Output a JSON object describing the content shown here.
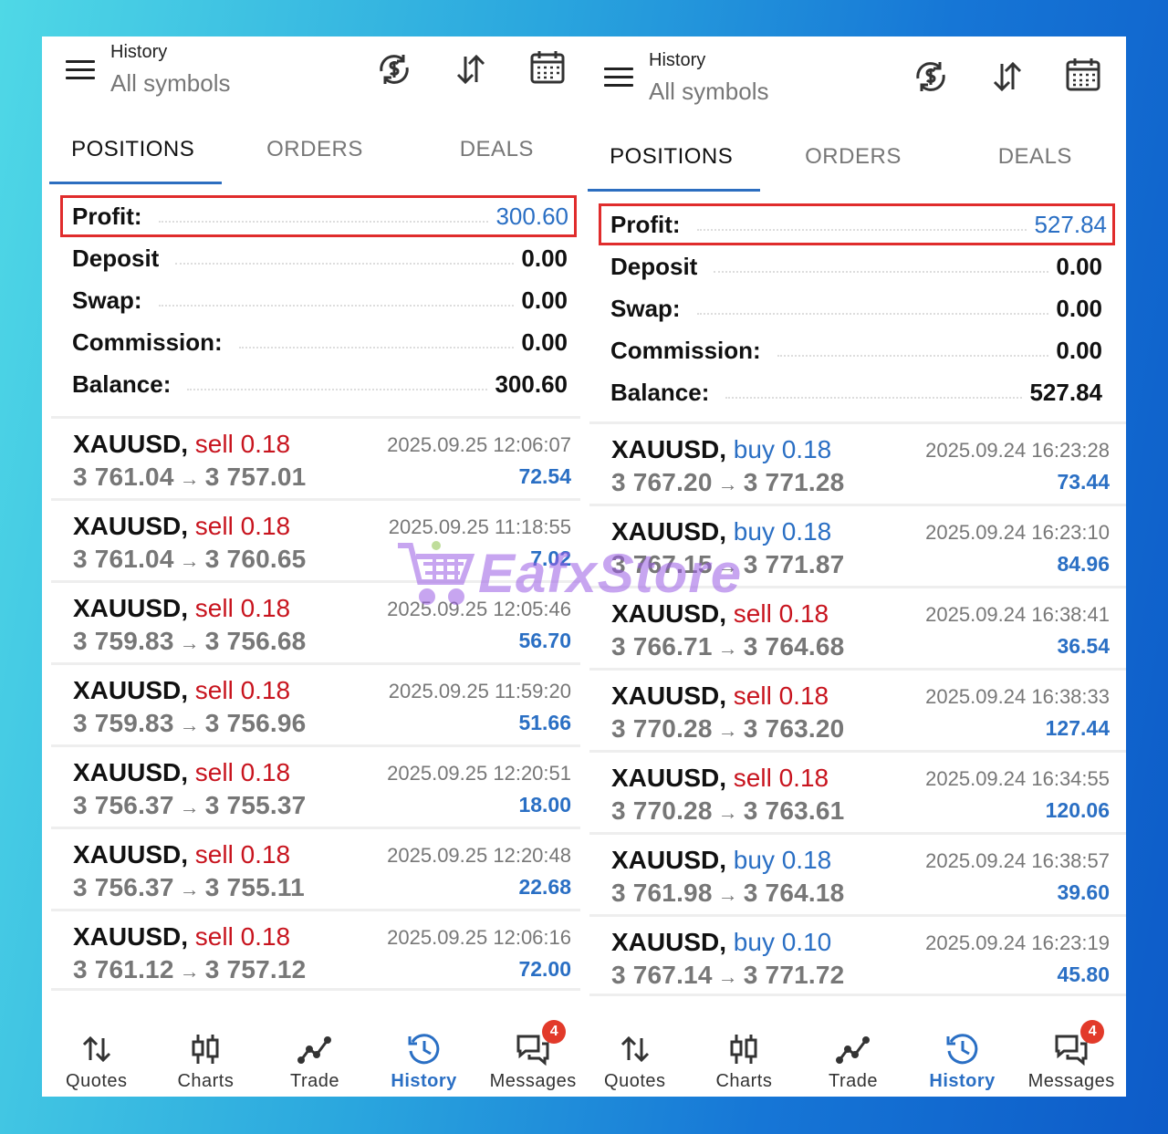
{
  "colors": {
    "profit_box": "#e02c2c",
    "accent_blue": "#2a6fc4",
    "sell_red": "#c8141e",
    "badge_red": "#e23a2a",
    "watermark_purple": "#9b5de5"
  },
  "watermark": {
    "text": "EafxStore",
    "icon": "shopping-cart-icon"
  },
  "left": {
    "header": {
      "title": "History",
      "subtitle": "All symbols"
    },
    "tabs": [
      {
        "label": "POSITIONS",
        "active": true
      },
      {
        "label": "ORDERS",
        "active": false
      },
      {
        "label": "DEALS",
        "active": false
      }
    ],
    "summary": {
      "profit": {
        "label": "Profit:",
        "value": "300.60"
      },
      "deposit": {
        "label": "Deposit",
        "value": "0.00"
      },
      "swap": {
        "label": "Swap:",
        "value": "0.00"
      },
      "commission": {
        "label": "Commission:",
        "value": "0.00"
      },
      "balance": {
        "label": "Balance:",
        "value": "300.60"
      }
    },
    "deals": [
      {
        "symbol": "XAUUSD,",
        "side": "sell 0.18",
        "type": "sell",
        "open": "3 761.04",
        "close": "3 757.01",
        "time": "2025.09.25 12:06:07",
        "profit": "72.54"
      },
      {
        "symbol": "XAUUSD,",
        "side": "sell 0.18",
        "type": "sell",
        "open": "3 761.04",
        "close": "3 760.65",
        "time": "2025.09.25 11:18:55",
        "profit": "7.02"
      },
      {
        "symbol": "XAUUSD,",
        "side": "sell 0.18",
        "type": "sell",
        "open": "3 759.83",
        "close": "3 756.68",
        "time": "2025.09.25 12:05:46",
        "profit": "56.70"
      },
      {
        "symbol": "XAUUSD,",
        "side": "sell 0.18",
        "type": "sell",
        "open": "3 759.83",
        "close": "3 756.96",
        "time": "2025.09.25 11:59:20",
        "profit": "51.66"
      },
      {
        "symbol": "XAUUSD,",
        "side": "sell 0.18",
        "type": "sell",
        "open": "3 756.37",
        "close": "3 755.37",
        "time": "2025.09.25 12:20:51",
        "profit": "18.00"
      },
      {
        "symbol": "XAUUSD,",
        "side": "sell 0.18",
        "type": "sell",
        "open": "3 756.37",
        "close": "3 755.11",
        "time": "2025.09.25 12:20:48",
        "profit": "22.68"
      },
      {
        "symbol": "XAUUSD,",
        "side": "sell 0.18",
        "type": "sell",
        "open": "3 761.12",
        "close": "3 757.12",
        "time": "2025.09.25 12:06:16",
        "profit": "72.00"
      }
    ],
    "nav": [
      {
        "label": "Quotes",
        "icon": "quotes-arrows-icon",
        "active": false
      },
      {
        "label": "Charts",
        "icon": "candlestick-chart-icon",
        "active": false
      },
      {
        "label": "Trade",
        "icon": "trade-line-icon",
        "active": false
      },
      {
        "label": "History",
        "icon": "history-clock-icon",
        "active": true
      },
      {
        "label": "Messages",
        "icon": "messages-chat-icon",
        "active": false,
        "badge": "4"
      }
    ]
  },
  "right": {
    "header": {
      "title": "History",
      "subtitle": "All symbols"
    },
    "tabs": [
      {
        "label": "POSITIONS",
        "active": true
      },
      {
        "label": "ORDERS",
        "active": false
      },
      {
        "label": "DEALS",
        "active": false
      }
    ],
    "summary": {
      "profit": {
        "label": "Profit:",
        "value": "527.84"
      },
      "deposit": {
        "label": "Deposit",
        "value": "0.00"
      },
      "swap": {
        "label": "Swap:",
        "value": "0.00"
      },
      "commission": {
        "label": "Commission:",
        "value": "0.00"
      },
      "balance": {
        "label": "Balance:",
        "value": "527.84"
      }
    },
    "deals": [
      {
        "symbol": "XAUUSD,",
        "side": "buy 0.18",
        "type": "buy",
        "open": "3 767.20",
        "close": "3 771.28",
        "time": "2025.09.24 16:23:28",
        "profit": "73.44"
      },
      {
        "symbol": "XAUUSD,",
        "side": "buy 0.18",
        "type": "buy",
        "open": "3 767.15",
        "close": "3 771.87",
        "time": "2025.09.24 16:23:10",
        "profit": "84.96"
      },
      {
        "symbol": "XAUUSD,",
        "side": "sell 0.18",
        "type": "sell",
        "open": "3 766.71",
        "close": "3 764.68",
        "time": "2025.09.24 16:38:41",
        "profit": "36.54"
      },
      {
        "symbol": "XAUUSD,",
        "side": "sell 0.18",
        "type": "sell",
        "open": "3 770.28",
        "close": "3 763.20",
        "time": "2025.09.24 16:38:33",
        "profit": "127.44"
      },
      {
        "symbol": "XAUUSD,",
        "side": "sell 0.18",
        "type": "sell",
        "open": "3 770.28",
        "close": "3 763.61",
        "time": "2025.09.24 16:34:55",
        "profit": "120.06"
      },
      {
        "symbol": "XAUUSD,",
        "side": "buy 0.18",
        "type": "buy",
        "open": "3 761.98",
        "close": "3 764.18",
        "time": "2025.09.24 16:38:57",
        "profit": "39.60"
      },
      {
        "symbol": "XAUUSD,",
        "side": "buy 0.10",
        "type": "buy",
        "open": "3 767.14",
        "close": "3 771.72",
        "time": "2025.09.24 16:23:19",
        "profit": "45.80"
      }
    ],
    "nav": [
      {
        "label": "Quotes",
        "icon": "quotes-arrows-icon",
        "active": false
      },
      {
        "label": "Charts",
        "icon": "candlestick-chart-icon",
        "active": false
      },
      {
        "label": "Trade",
        "icon": "trade-line-icon",
        "active": false
      },
      {
        "label": "History",
        "icon": "history-clock-icon",
        "active": true
      },
      {
        "label": "Messages",
        "icon": "messages-chat-icon",
        "active": false,
        "badge": "4"
      }
    ]
  }
}
